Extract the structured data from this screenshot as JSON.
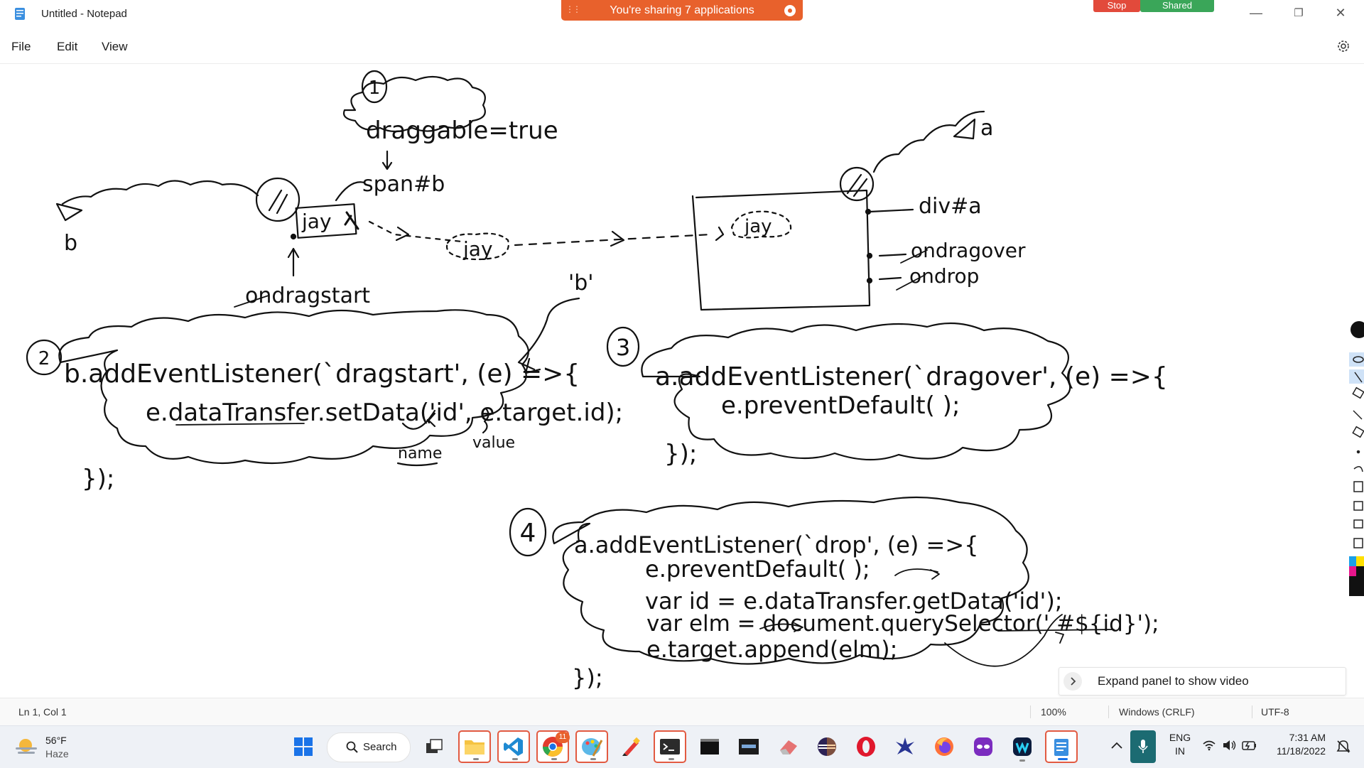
{
  "window": {
    "title": "Untitled - Notepad"
  },
  "sharing": {
    "banner": "You're sharing 7 applications",
    "stop": "Stop",
    "shared": "Shared"
  },
  "menu": {
    "file": "File",
    "edit": "Edit",
    "view": "View"
  },
  "drawing": {
    "n1": "1",
    "n2": "2",
    "n3": "3",
    "n4": "4",
    "cloud1": "draggable=true",
    "span_label": "span#b",
    "jay": "jay",
    "b_label": "b",
    "a_label": "a",
    "ondragstart": "ondragstart",
    "quote_b": "'b'",
    "div_label": "div#a",
    "ondragover": "ondragover",
    "ondrop": "ondrop",
    "c2_line1": "b.addEventListener(`dragstart', (e) =>{",
    "c2_line2": "e.dataTransfer.setData('id', e.target.id);",
    "c2_name": "name",
    "c2_value": "value",
    "c2_close": "});",
    "c3_line1": "a.addEventListener(`dragover', (e) =>{",
    "c3_line2": "e.preventDefault( );",
    "c3_close": "});",
    "c4_line1": "a.addEventListener(`drop', (e) =>{",
    "c4_line2": "e.preventDefault( );",
    "c4_line3": "var id = e.dataTransfer.getData('id');",
    "c4_line4": "var elm = document.querySelector(' #${id}');",
    "c4_line5": "e.target.append(elm);",
    "c4_close": "});"
  },
  "expand_panel": {
    "label": "Expand panel to show video"
  },
  "status": {
    "position": "Ln 1, Col 1",
    "zoom": "100%",
    "line_ending": "Windows (CRLF)",
    "encoding": "UTF-8"
  },
  "taskbar": {
    "weather_temp": "56°F",
    "weather_desc": "Haze",
    "search": "Search",
    "lang_top": "ENG",
    "lang_bottom": "IN",
    "time": "7:31 AM",
    "date": "11/18/2022",
    "chrome_badge": "11"
  }
}
